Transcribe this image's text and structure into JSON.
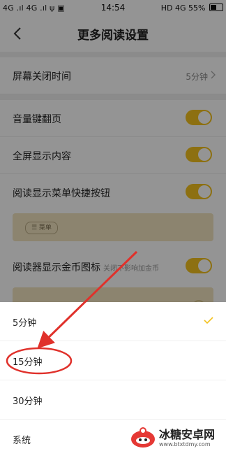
{
  "status_bar": {
    "left": "4G .ıl 4G .ıl ψ ▣",
    "time": "14:54",
    "right": "HD 4G 55%"
  },
  "header": {
    "title": "更多阅读设置"
  },
  "settings": {
    "screen_off": {
      "label": "屏幕关闭时间",
      "value": "5分钟"
    },
    "volume_key": {
      "label": "音量键翻页",
      "on": true
    },
    "fullscreen": {
      "label": "全屏显示内容",
      "on": true
    },
    "menu_shortcut": {
      "label": "阅读显示菜单快捷按钮",
      "on": true,
      "preview_label": "☰ 菜单"
    },
    "coin_icon": {
      "label": "阅读器显示金币图标",
      "note": "关闭不影响加金币",
      "on": true
    }
  },
  "sheet": {
    "options": [
      {
        "label": "5分钟",
        "selected": true
      },
      {
        "label": "15分钟",
        "selected": false
      },
      {
        "label": "30分钟",
        "selected": false
      },
      {
        "label": "系统",
        "selected": false
      }
    ]
  },
  "colors": {
    "accent": "#f3c21e",
    "annotation": "#e0312b"
  },
  "watermark": {
    "name": "冰糖安卓网",
    "url": "www.btxtdmy.com"
  }
}
